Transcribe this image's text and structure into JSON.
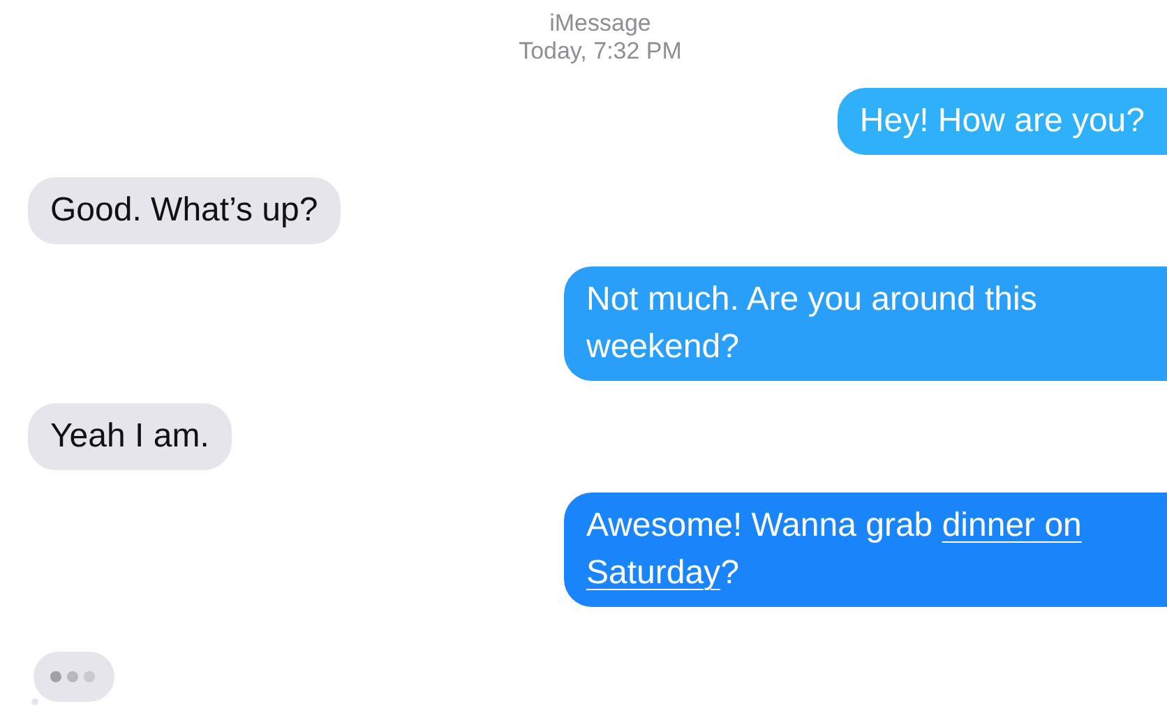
{
  "header": {
    "service": "iMessage",
    "timestamp": "Today, 7:32 PM"
  },
  "messages": [
    {
      "kind": "sent",
      "color": "#2eb1f9",
      "parts": [
        {
          "text": "Hey! How are you?"
        }
      ]
    },
    {
      "kind": "received",
      "color": "#e6e5eb",
      "parts": [
        {
          "text": "Good. What’s up?"
        }
      ]
    },
    {
      "kind": "sent",
      "color": "#2a9ff9",
      "parts": [
        {
          "text": "Not much. Are you around this weekend?"
        }
      ]
    },
    {
      "kind": "received",
      "color": "#e6e5eb",
      "parts": [
        {
          "text": "Yeah I am."
        }
      ]
    },
    {
      "kind": "sent",
      "color": "#1a84fb",
      "parts": [
        {
          "text": "Awesome! Wanna grab "
        },
        {
          "text": "dinner on",
          "kind": "link"
        },
        {
          "text": "Saturday",
          "kind": "link"
        },
        {
          "text": "?"
        }
      ]
    }
  ],
  "typing_indicator": {
    "kind": "received"
  }
}
